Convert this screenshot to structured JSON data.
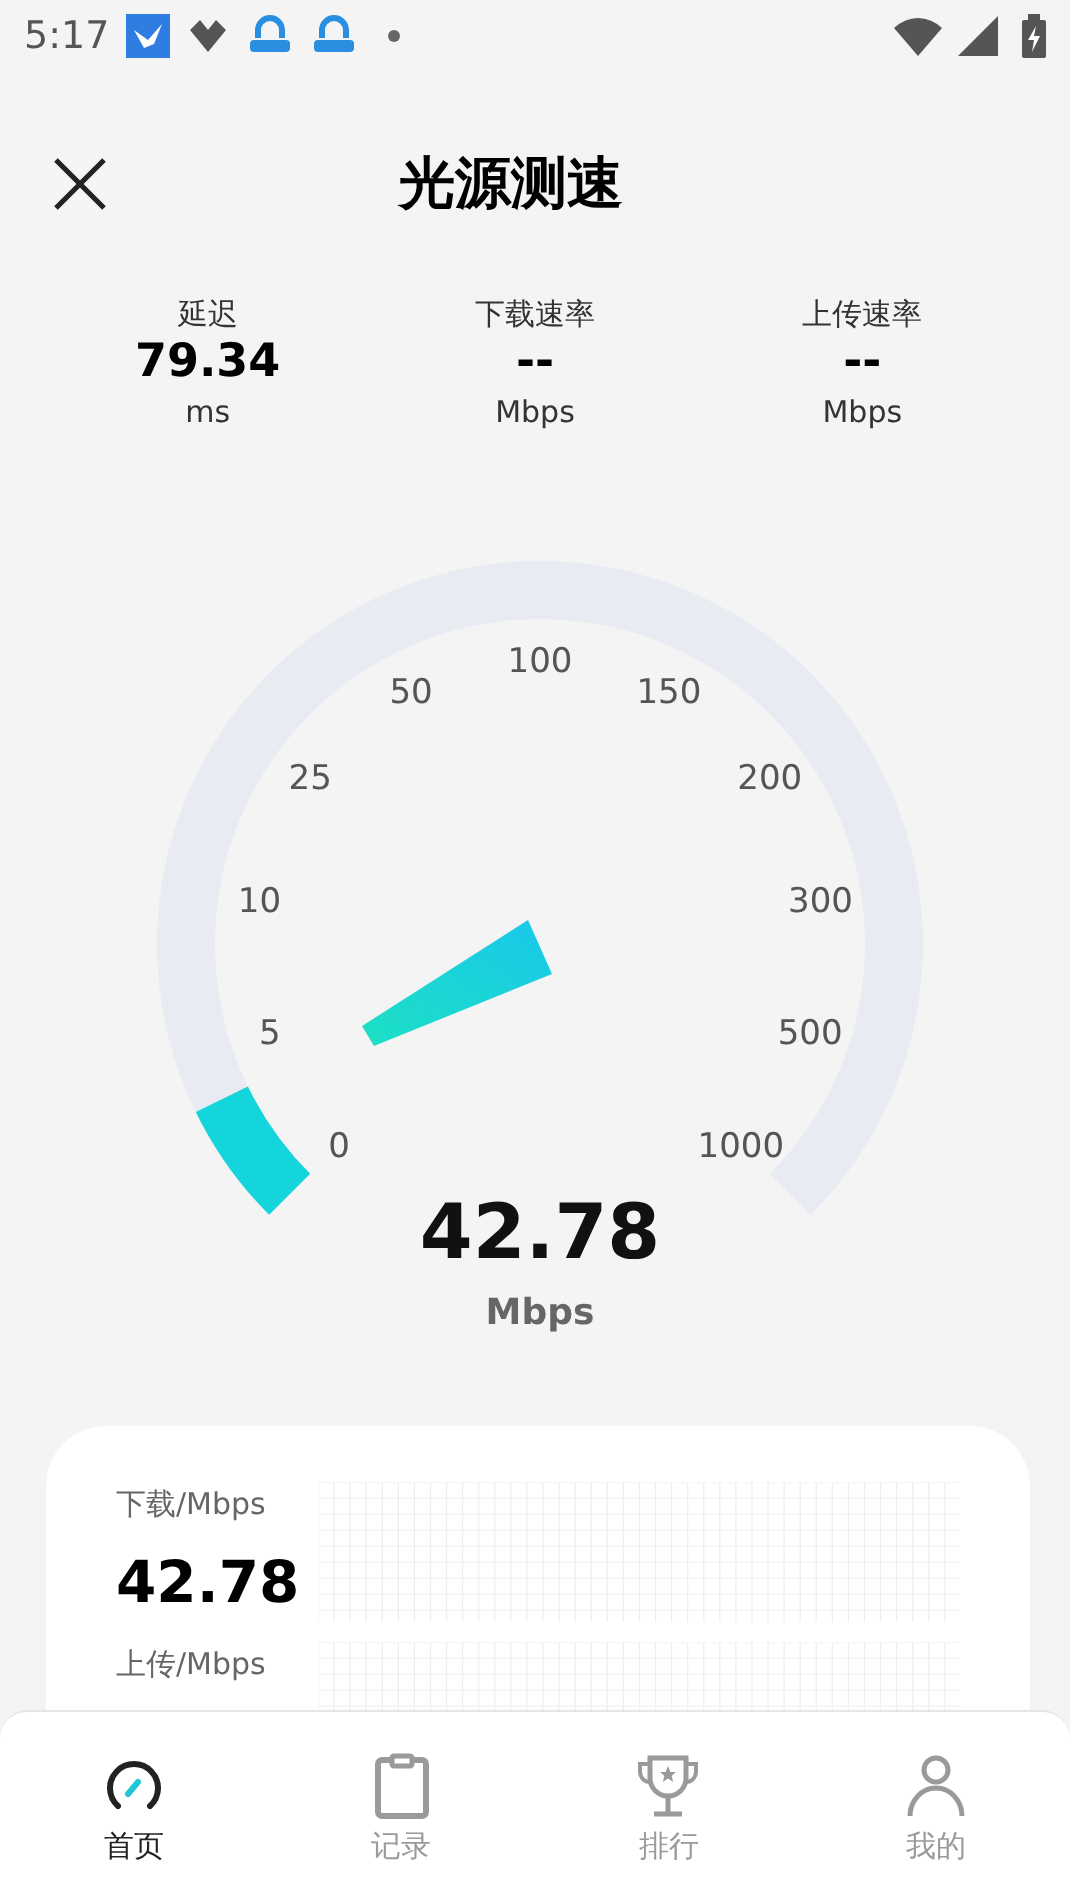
{
  "status_bar": {
    "time": "5:17"
  },
  "header": {
    "title": "光源测速"
  },
  "stats": [
    {
      "label": "延迟",
      "value": "79.34",
      "unit": "ms"
    },
    {
      "label": "下载速率",
      "value": "--",
      "unit": "Mbps"
    },
    {
      "label": "上传速率",
      "value": "--",
      "unit": "Mbps"
    }
  ],
  "gauge": {
    "ticks": [
      "0",
      "5",
      "10",
      "25",
      "50",
      "100",
      "150",
      "200",
      "300",
      "500",
      "1000"
    ],
    "value": "42.78",
    "unit": "Mbps"
  },
  "card": {
    "rows": [
      {
        "label": "下载/Mbps",
        "value": "42.78"
      },
      {
        "label": "上传/Mbps"
      }
    ]
  },
  "nav": [
    {
      "label": "首页",
      "selected": true
    },
    {
      "label": "记录",
      "selected": false
    },
    {
      "label": "排行",
      "selected": false
    },
    {
      "label": "我的",
      "selected": false
    }
  ]
}
